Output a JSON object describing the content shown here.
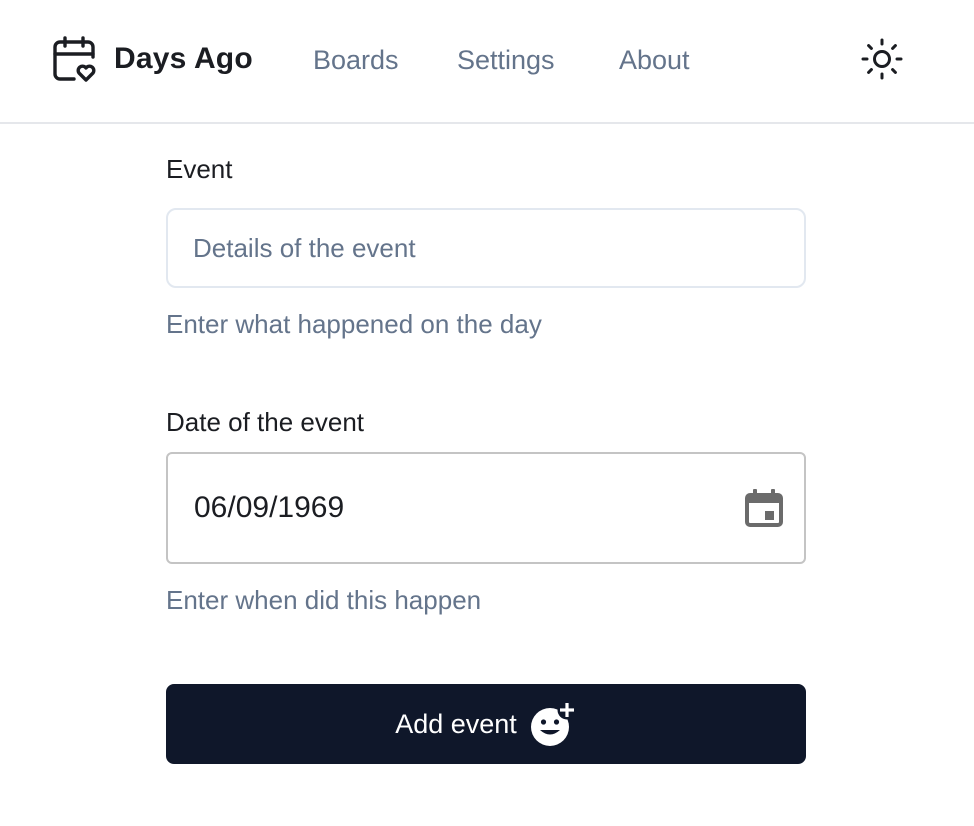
{
  "header": {
    "brand": {
      "name": "Days Ago",
      "icon": "calendar-heart-icon"
    },
    "nav": [
      {
        "label": "Boards"
      },
      {
        "label": "Settings"
      },
      {
        "label": "About"
      }
    ],
    "theme_toggle_icon": "sun-icon"
  },
  "form": {
    "event": {
      "label": "Event",
      "placeholder": "Details of the event",
      "value": "",
      "helper": "Enter what happened on the day"
    },
    "date": {
      "label": "Date of the event",
      "value": "06/09/1969",
      "helper": "Enter when did this happen",
      "icon": "calendar-icon"
    },
    "submit": {
      "label": "Add event",
      "icon": "add-reaction-icon"
    }
  },
  "colors": {
    "text": "#1b1d22",
    "muted": "#64748b",
    "button_bg": "#0f172a",
    "border": "#e2e8f0"
  }
}
